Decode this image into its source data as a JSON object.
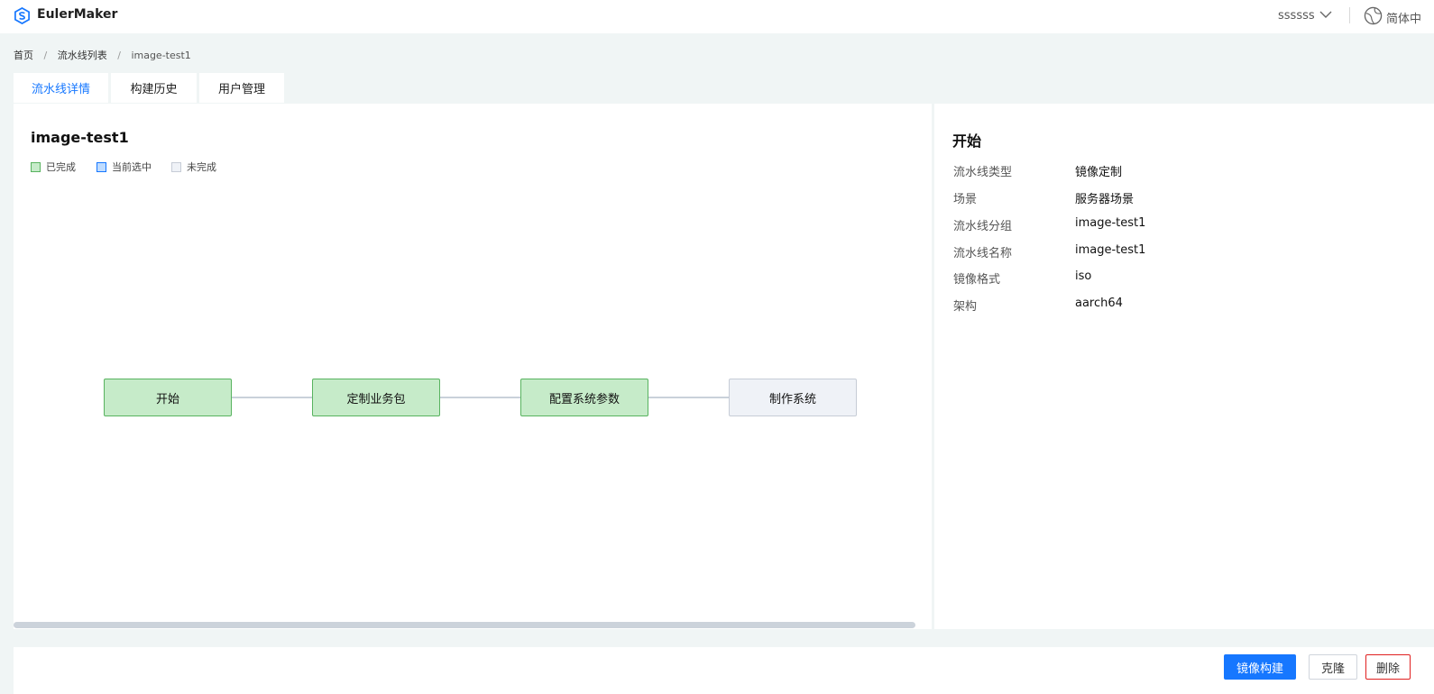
{
  "app": {
    "name": "EulerMaker",
    "user": "ssssss",
    "language": "简体中"
  },
  "breadcrumb": {
    "home": "首页",
    "list": "流水线列表",
    "current": "image-test1",
    "sep": "/"
  },
  "tabs": [
    {
      "label": "流水线详情",
      "active": true
    },
    {
      "label": "构建历史",
      "active": false
    },
    {
      "label": "用户管理",
      "active": false
    }
  ],
  "pipeline": {
    "title": "image-test1",
    "legend": [
      {
        "label": "已完成",
        "color": "#c6ebc9",
        "border": "#58b35f"
      },
      {
        "label": "当前选中",
        "color": "#bfdcff",
        "border": "#1677ff"
      },
      {
        "label": "未完成",
        "color": "#eff2f7",
        "border": "#c6ccd6"
      }
    ],
    "stages": [
      {
        "label": "开始",
        "status": "done"
      },
      {
        "label": "定制业务包",
        "status": "done"
      },
      {
        "label": "配置系统参数",
        "status": "done"
      },
      {
        "label": "制作系统",
        "status": "todo"
      }
    ]
  },
  "details": {
    "title": "开始",
    "rows": [
      {
        "label": "流水线类型",
        "value": "镜像定制"
      },
      {
        "label": "场景",
        "value": "服务器场景"
      },
      {
        "label": "流水线分组",
        "value": "image-test1"
      },
      {
        "label": "流水线名称",
        "value": "image-test1"
      },
      {
        "label": "镜像格式",
        "value": "iso"
      },
      {
        "label": "架构",
        "value": "aarch64"
      }
    ]
  },
  "actions": {
    "build": "镜像构建",
    "clone": "克隆",
    "delete": "删除"
  },
  "colors": {
    "accent": "#1677ff",
    "done": "#c6ebc9",
    "todo": "#eff2f7",
    "danger": "#e02020"
  }
}
